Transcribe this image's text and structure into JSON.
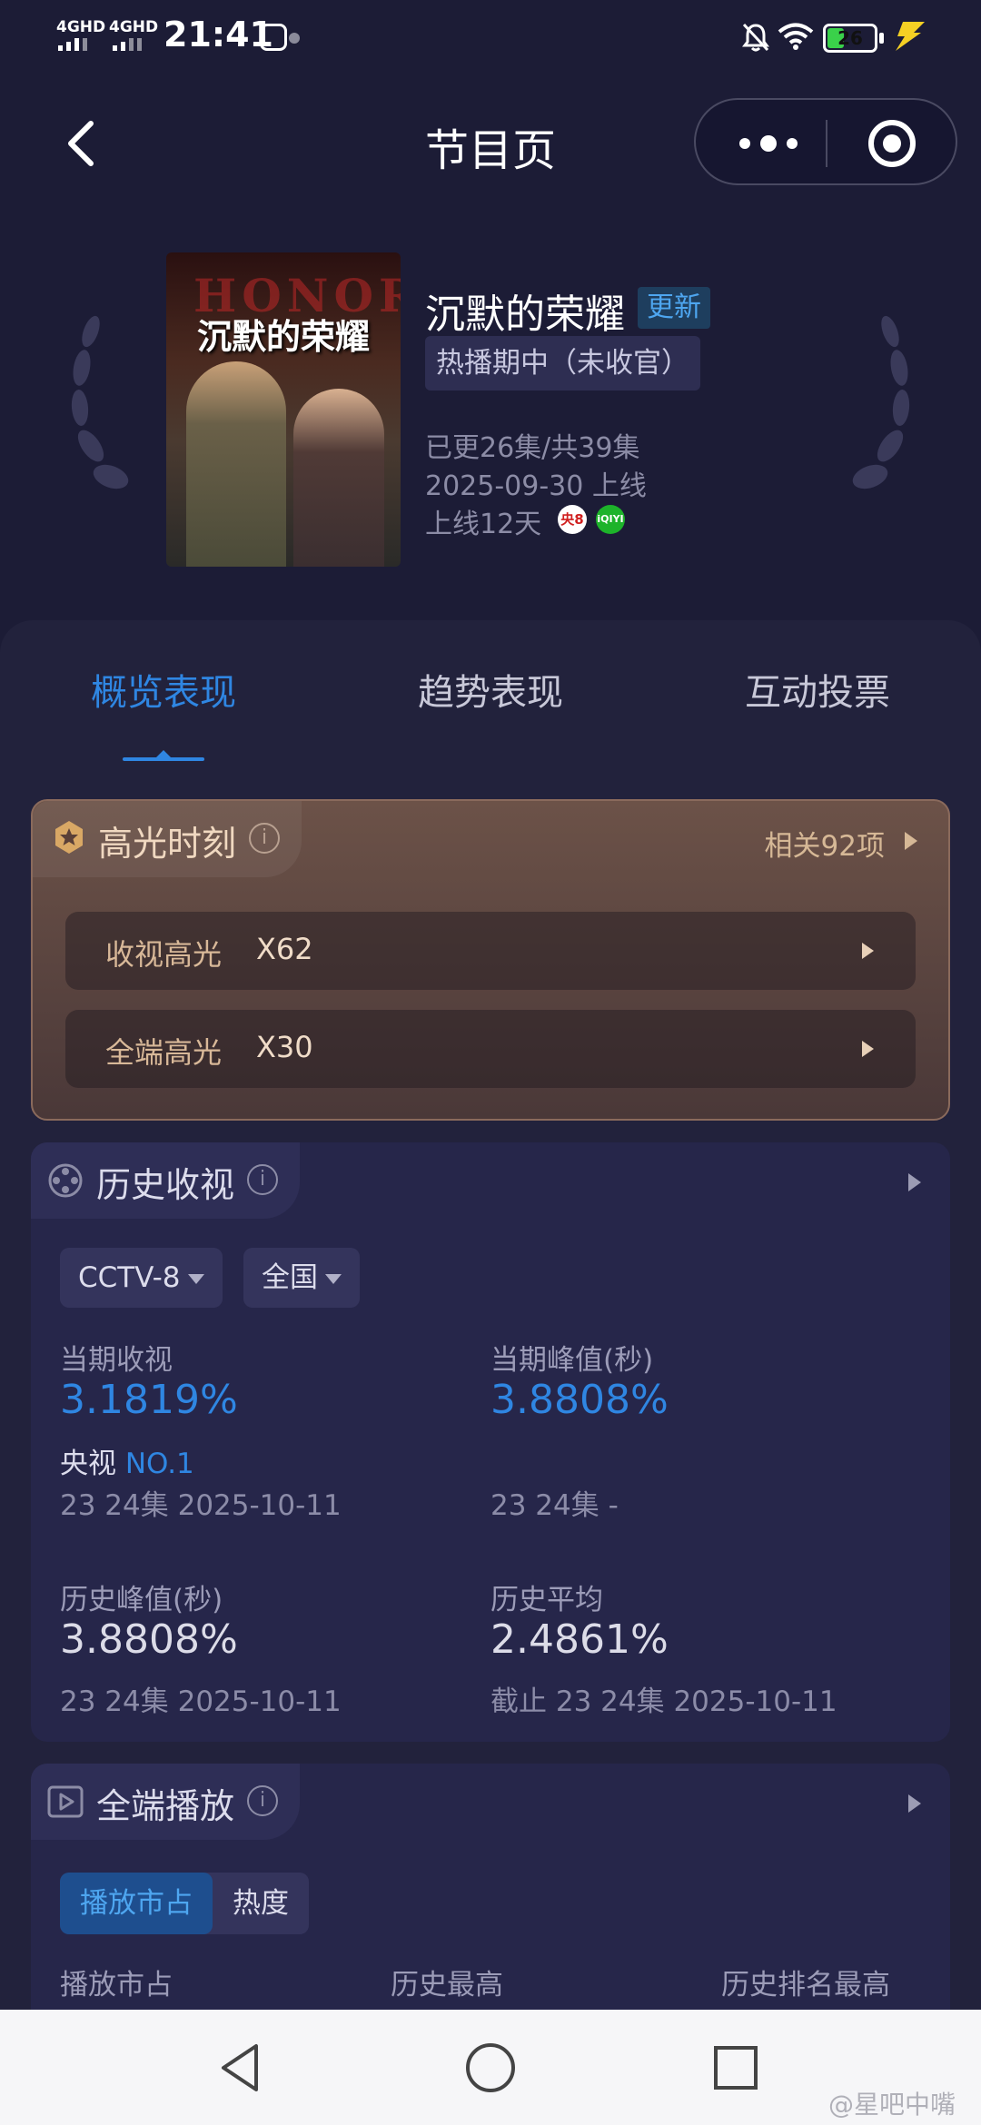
{
  "status_bar": {
    "net1": "4GHD",
    "net2": "4GHD",
    "time": "21:41",
    "battery": "26"
  },
  "header": {
    "title": "节目页"
  },
  "program": {
    "poster_title": "沉默的荣耀",
    "poster_bg_text": "HONOR",
    "name": "沉默的荣耀",
    "update_tag": "更新",
    "status": "热播期中（未收官）",
    "episodes": "已更26集/共39集",
    "release": "2025-09-30 上线",
    "days_online": "上线12天",
    "platform_cctv": "央8",
    "platform_iqiyi": "iQIYI"
  },
  "tabs": [
    "概览表现",
    "趋势表现",
    "互动投票"
  ],
  "highlights": {
    "title": "高光时刻",
    "info": "i",
    "related": "相关92项",
    "rows": [
      {
        "label": "收视高光",
        "value": "X62"
      },
      {
        "label": "全端高光",
        "value": "X30"
      }
    ]
  },
  "ratings": {
    "title": "历史收视",
    "info": "i",
    "channel": "CCTV-8",
    "region": "全国",
    "current_label": "当期收视",
    "current_value": "3.1819%",
    "rank_prefix": "央视",
    "rank": "NO.1",
    "current_sub": "23 24集 2025-10-11",
    "peak_label": "当期峰值(秒)",
    "peak_value": "3.8808%",
    "peak_sub": "23 24集 -",
    "hist_peak_label": "历史峰值(秒)",
    "hist_peak_value": "3.8808%",
    "hist_peak_sub": "23 24集 2025-10-11",
    "hist_avg_label": "历史平均",
    "hist_avg_value": "2.4861%",
    "hist_avg_sub": "截止 23 24集 2025-10-11"
  },
  "playback": {
    "title": "全端播放",
    "info": "i",
    "seg_share": "播放市占",
    "seg_heat": "热度",
    "col1": "播放市占",
    "col2": "历史最高",
    "col3": "历史排名最高"
  },
  "watermark": "@星吧中嘴",
  "colors": {
    "accent": "#2f86e2",
    "background": "#1c1c36",
    "highlight_card": "#6c5248"
  }
}
